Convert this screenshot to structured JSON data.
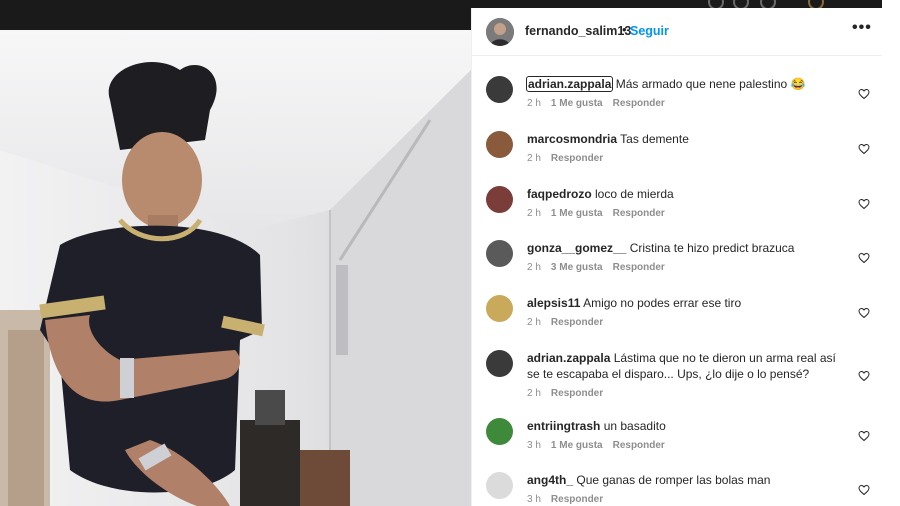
{
  "post": {
    "username": "fernando_salim13",
    "separator": "•",
    "follow_label": "Seguir",
    "more_label": "•••"
  },
  "comments": [
    {
      "user": "adrian.zappala",
      "text": "Más armado que nene palestino 😂",
      "time": "2 h",
      "likes": "1 Me gusta",
      "reply": "Responder",
      "avatar_color": "#3a3a3a"
    },
    {
      "user": "marcosmondria",
      "text": "Tas demente",
      "time": "2 h",
      "likes": "",
      "reply": "Responder",
      "avatar_color": "#8a5a3c"
    },
    {
      "user": "faqpedrozo",
      "text": "loco de mierda",
      "time": "2 h",
      "likes": "1 Me gusta",
      "reply": "Responder",
      "avatar_color": "#7a3d3a"
    },
    {
      "user": "gonza__gomez__",
      "text": "Cristina te hizo predict brazuca",
      "time": "2 h",
      "likes": "3 Me gusta",
      "reply": "Responder",
      "avatar_color": "#5a5a5a"
    },
    {
      "user": "alepsis11",
      "text": "Amigo no podes errar ese tiro",
      "time": "2 h",
      "likes": "",
      "reply": "Responder",
      "avatar_color": "#c9a95a"
    },
    {
      "user": "adrian.zappala",
      "text": "Lástima que no te dieron un arma real así se te escapaba el disparo... Ups, ¿lo dije o lo pensé?",
      "time": "2 h",
      "likes": "",
      "reply": "Responder",
      "avatar_color": "#3a3a3a"
    },
    {
      "user": "entriingtrash",
      "text": "un basadito",
      "time": "3 h",
      "likes": "1 Me gusta",
      "reply": "Responder",
      "avatar_color": "#3f8a3a"
    },
    {
      "user": "ang4th_",
      "text": "Que ganas de romper las bolas man",
      "time": "3 h",
      "likes": "",
      "reply": "Responder",
      "avatar_color": "#dbdbdb"
    }
  ]
}
